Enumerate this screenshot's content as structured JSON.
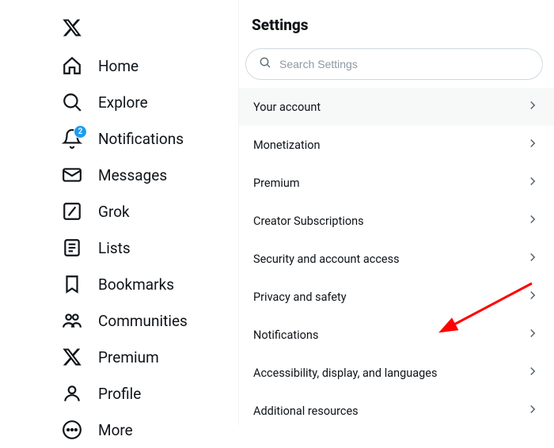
{
  "sidebar": {
    "logo": "x-logo-icon",
    "items": [
      {
        "icon": "home-icon",
        "label": "Home"
      },
      {
        "icon": "search-icon",
        "label": "Explore"
      },
      {
        "icon": "bell-icon",
        "label": "Notifications",
        "badge": "2"
      },
      {
        "icon": "mail-icon",
        "label": "Messages"
      },
      {
        "icon": "slash-square-icon",
        "label": "Grok"
      },
      {
        "icon": "list-icon",
        "label": "Lists"
      },
      {
        "icon": "bookmark-icon",
        "label": "Bookmarks"
      },
      {
        "icon": "communities-icon",
        "label": "Communities"
      },
      {
        "icon": "x-logo-icon",
        "label": "Premium"
      },
      {
        "icon": "profile-icon",
        "label": "Profile"
      },
      {
        "icon": "more-circle-icon",
        "label": "More"
      }
    ]
  },
  "main": {
    "title": "Settings",
    "search_placeholder": "Search Settings",
    "items": [
      {
        "label": "Your account",
        "active": true
      },
      {
        "label": "Monetization"
      },
      {
        "label": "Premium"
      },
      {
        "label": "Creator Subscriptions"
      },
      {
        "label": "Security and account access"
      },
      {
        "label": "Privacy and safety"
      },
      {
        "label": "Notifications"
      },
      {
        "label": "Accessibility, display, and languages"
      },
      {
        "label": "Additional resources"
      }
    ]
  },
  "annotation": {
    "type": "red-arrow",
    "points_to": "Accessibility, display, and languages"
  }
}
